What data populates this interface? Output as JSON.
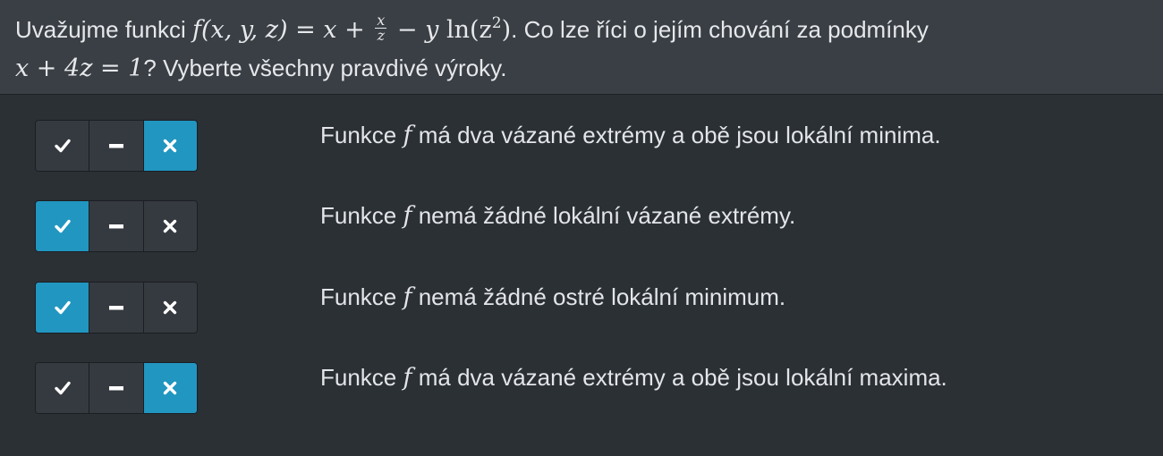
{
  "question": {
    "intro": "Uvažujme funkci",
    "func_lhs": "f(x, y, z)",
    "func_eq": " = x + ",
    "frac_num": "x",
    "frac_den": "z",
    "func_rest_a": " − y ",
    "func_ln": "ln",
    "func_rest_b": "(z",
    "func_exp": "2",
    "func_close": ")",
    "after_func": ". Co lze říci o jejím chování za podmínky",
    "condition": "x + 4z = 1",
    "closing": "? Vyberte všechny pravdivé výroky."
  },
  "toggle_icons": [
    "check-icon",
    "minus-icon",
    "cross-icon"
  ],
  "colors": {
    "background": "#2b3035",
    "header": "#3a3f45",
    "active_segment": "#2196c0",
    "segment": "#353a40"
  },
  "options": [
    {
      "prefix": "Funkce ",
      "symbol": "f",
      "suffix": " má dva vázané extrémy a obě jsou lokální minima.",
      "selected": "no"
    },
    {
      "prefix": "Funkce ",
      "symbol": "f",
      "suffix": " nemá žádné lokální vázané extrémy.",
      "selected": "yes"
    },
    {
      "prefix": "Funkce ",
      "symbol": "f",
      "suffix": " nemá žádné ostré lokální minimum.",
      "selected": "yes"
    },
    {
      "prefix": "Funkce ",
      "symbol": "f",
      "suffix": " má dva vázané extrémy a obě jsou lokální maxima.",
      "selected": "no"
    }
  ]
}
